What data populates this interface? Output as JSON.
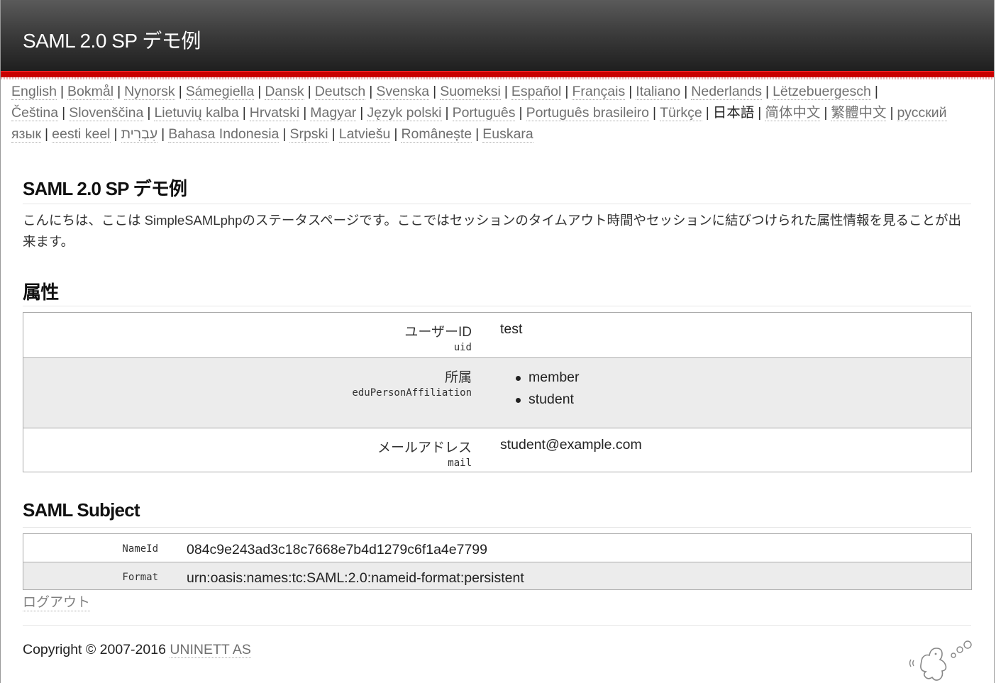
{
  "header": {
    "title": "SAML 2.0 SP デモ例"
  },
  "languages": {
    "items": [
      {
        "label": "English",
        "current": false
      },
      {
        "label": "Bokmål",
        "current": false
      },
      {
        "label": "Nynorsk",
        "current": false
      },
      {
        "label": "Sámegiella",
        "current": false
      },
      {
        "label": "Dansk",
        "current": false
      },
      {
        "label": "Deutsch",
        "current": false
      },
      {
        "label": "Svenska",
        "current": false
      },
      {
        "label": "Suomeksi",
        "current": false
      },
      {
        "label": "Español",
        "current": false
      },
      {
        "label": "Français",
        "current": false
      },
      {
        "label": "Italiano",
        "current": false
      },
      {
        "label": "Nederlands",
        "current": false
      },
      {
        "label": "Lëtzebuergesch",
        "current": false
      },
      {
        "label": "Čeština",
        "current": false
      },
      {
        "label": "Slovenščina",
        "current": false
      },
      {
        "label": "Lietuvių kalba",
        "current": false
      },
      {
        "label": "Hrvatski",
        "current": false
      },
      {
        "label": "Magyar",
        "current": false
      },
      {
        "label": "Język polski",
        "current": false
      },
      {
        "label": "Português",
        "current": false
      },
      {
        "label": "Português brasileiro",
        "current": false
      },
      {
        "label": "Türkçe",
        "current": false
      },
      {
        "label": "日本語",
        "current": true
      },
      {
        "label": "简体中文",
        "current": false
      },
      {
        "label": "繁體中文",
        "current": false
      },
      {
        "label": "русский язык",
        "current": false
      },
      {
        "label": "eesti keel",
        "current": false
      },
      {
        "label": "עִבְרִית",
        "current": false
      },
      {
        "label": "Bahasa Indonesia",
        "current": false
      },
      {
        "label": "Srpski",
        "current": false
      },
      {
        "label": "Latviešu",
        "current": false
      },
      {
        "label": "Românește",
        "current": false
      },
      {
        "label": "Euskara",
        "current": false
      }
    ],
    "separator": "|"
  },
  "main": {
    "heading": "SAML 2.0 SP デモ例",
    "intro": "こんにちは、ここは SimpleSAMLphpのステータスページです。ここではセッションのタイムアウト時間やセッションに結びつけられた属性情報を見ることが出来ます。",
    "attributes_heading": "属性",
    "attributes": [
      {
        "name": "ユーザーID",
        "key": "uid",
        "value": "test"
      },
      {
        "name": "所属",
        "key": "eduPersonAffiliation",
        "values": [
          "member",
          "student"
        ]
      },
      {
        "name": "メールアドレス",
        "key": "mail",
        "value": "student@example.com"
      }
    ],
    "subject_heading": "SAML Subject",
    "subject": [
      {
        "key": "NameId",
        "value": "084c9e243ad3c18c7668e7b4d1279c6f1a4e7799"
      },
      {
        "key": "Format",
        "value": "urn:oasis:names:tc:SAML:2.0:nameid-format:persistent"
      }
    ],
    "logout_label": "ログアウト"
  },
  "footer": {
    "copyright": "Copyright © 2007-2016 ",
    "company": "UNINETT AS",
    "logo_icon": "simplesamlphp-logo-icon"
  }
}
